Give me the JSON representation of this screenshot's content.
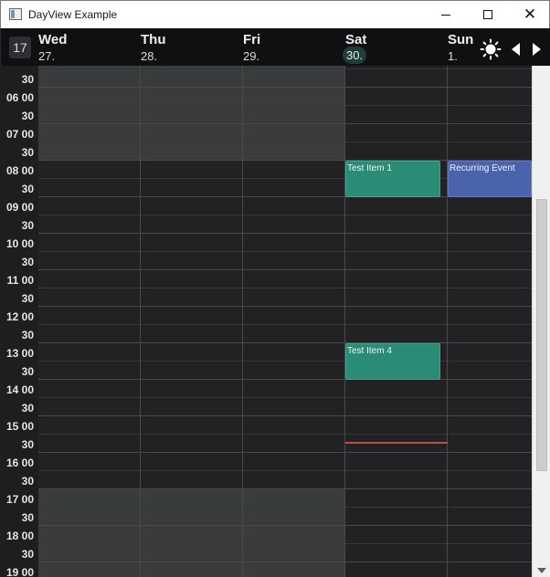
{
  "window": {
    "title": "DayView Example",
    "minimize_symbol": "—",
    "maximize_symbol": "☐",
    "close_symbol": "✕"
  },
  "header": {
    "week_number": "17",
    "days": [
      {
        "name": "Wed",
        "number": "27.",
        "today": false
      },
      {
        "name": "Thu",
        "number": "28.",
        "today": false
      },
      {
        "name": "Fri",
        "number": "29.",
        "today": false
      },
      {
        "name": "Sat",
        "number": "30.",
        "today": true
      },
      {
        "name": "Sun",
        "number": "1.",
        "today": false
      }
    ],
    "theme_icon": "sun-icon",
    "prev_icon": "triangle-left-icon",
    "next_icon": "triangle-right-icon"
  },
  "time_labels": [
    "30",
    "06 00",
    "30",
    "07 00",
    "30",
    "08 00",
    "30",
    "09 00",
    "30",
    "10 00",
    "30",
    "11 00",
    "30",
    "12 00",
    "30",
    "13 00",
    "30",
    "14 00",
    "30",
    "15 00",
    "30",
    "16 00",
    "30",
    "17 00",
    "30",
    "18 00",
    "30",
    "19 00"
  ],
  "events": [
    {
      "title": "Test Item 1",
      "day": "Sat",
      "start": "08:00",
      "end": "09:00",
      "color": "green"
    },
    {
      "title": "Recurring Event",
      "day": "Sun",
      "start": "08:00",
      "end": "09:00",
      "color": "blue"
    },
    {
      "title": "Test Item 4",
      "day": "Sat",
      "start": "13:00",
      "end": "14:00",
      "color": "green"
    }
  ],
  "current_time": {
    "day": "Sat",
    "time": "16:00"
  },
  "colors": {
    "background": "#222225",
    "off_hours": "#3a3b3d",
    "event_green": "#2a8c77",
    "event_blue": "#4b63ad",
    "now_line": "#c44a4a",
    "today_badge": "#1f3e38"
  }
}
